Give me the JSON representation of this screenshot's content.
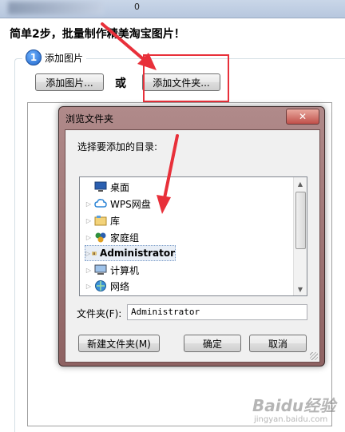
{
  "window": {
    "title_fragment": "0"
  },
  "headline": "简单2步，批量制作精美淘宝图片！",
  "step": {
    "number": "1",
    "label": "添加图片"
  },
  "buttons": {
    "add_image": "添加图片...",
    "or": "或",
    "add_folder": "添加文件夹..."
  },
  "dialog": {
    "title": "浏览文件夹",
    "close": "✕",
    "prompt": "选择要添加的目录:",
    "tree": [
      {
        "label": "桌面",
        "icon": "desktop-icon",
        "expandable": false
      },
      {
        "label": "WPS网盘",
        "icon": "cloud-icon",
        "expandable": true
      },
      {
        "label": "库",
        "icon": "library-icon",
        "expandable": true
      },
      {
        "label": "家庭组",
        "icon": "homegroup-icon",
        "expandable": true
      },
      {
        "label": "Administrator",
        "icon": "user-folder-icon",
        "expandable": true,
        "selected": true
      },
      {
        "label": "计算机",
        "icon": "computer-icon",
        "expandable": true
      },
      {
        "label": "网络",
        "icon": "network-icon",
        "expandable": true
      }
    ],
    "folder_label": "文件夹(F):",
    "folder_value": "Administrator",
    "new_folder": "新建文件夹(M)",
    "ok": "确定",
    "cancel": "取消"
  },
  "watermark": {
    "brand": "Baidu经验",
    "url": "jingyan.baidu.com"
  },
  "colors": {
    "highlight": "#e8303a",
    "dialog_frame": "#8e6262"
  }
}
